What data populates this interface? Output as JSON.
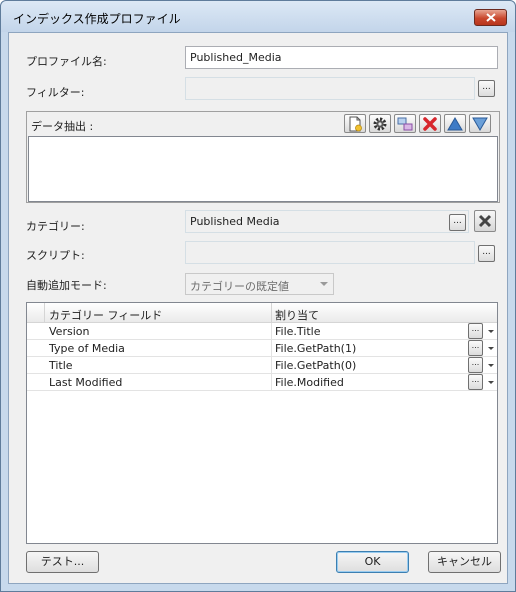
{
  "window": {
    "title": "インデックス作成プロファイル"
  },
  "profile_name": {
    "label": "プロファイル名:",
    "value": "Published_Media"
  },
  "filter": {
    "label": "フィルター:",
    "value": "",
    "browse": "..."
  },
  "data_extraction": {
    "label": "データ抽出 :",
    "toolbar": [
      "new-icon",
      "gear-icon",
      "transform-icon",
      "delete-icon",
      "move-up-icon",
      "move-down-icon"
    ]
  },
  "category": {
    "label": "カテゴリー:",
    "value": "Published Media",
    "browse": "..."
  },
  "script": {
    "label": "スクリプト:",
    "value": "",
    "browse": "..."
  },
  "auto_add_mode": {
    "label": "自動追加モード:",
    "value": "カテゴリーの既定値"
  },
  "grid": {
    "columns": [
      "カテゴリー フィールド",
      "割り当て"
    ],
    "rows": [
      {
        "field": "Version",
        "assignment": "File.Title",
        "button": "..."
      },
      {
        "field": "Type of Media",
        "assignment": "File.GetPath(1)",
        "button": "..."
      },
      {
        "field": "Title",
        "assignment": "File.GetPath(0)",
        "button": "..."
      },
      {
        "field": "Last Modified",
        "assignment": "File.Modified",
        "button": "..."
      }
    ]
  },
  "buttons": {
    "test": "テスト...",
    "ok": "OK",
    "cancel": "キャンセル"
  },
  "colors": {
    "close_button": "#c9482e",
    "move_arrows": "#3e7bc6",
    "delete": "#d7262c",
    "accent": "#3c7fb1"
  }
}
